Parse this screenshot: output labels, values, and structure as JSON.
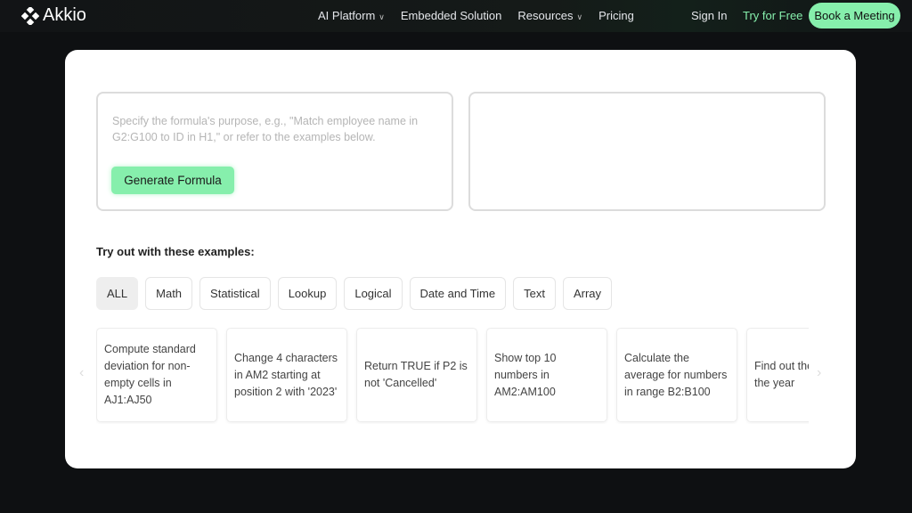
{
  "nav": {
    "brand": "Akkio",
    "links": [
      {
        "label": "AI Platform",
        "dropdown": true
      },
      {
        "label": "Embedded Solution",
        "dropdown": false
      },
      {
        "label": "Resources",
        "dropdown": true
      },
      {
        "label": "Pricing",
        "dropdown": false
      }
    ],
    "sign_in": "Sign In",
    "try_free": "Try for Free",
    "book_meeting": "Book a Meeting"
  },
  "form": {
    "placeholder": "Specify the formula's purpose, e.g., \"Match employee name in G2:G100 to ID in H1,\" or refer to the examples below.",
    "generate_label": "Generate Formula",
    "output": ""
  },
  "examples": {
    "heading": "Try out with these examples:",
    "categories": [
      "ALL",
      "Math",
      "Statistical",
      "Lookup",
      "Logical",
      "Date and Time",
      "Text",
      "Array"
    ],
    "active": "ALL",
    "cards": [
      "Compute standard deviation for non-empty cells in AJ1:AJ50",
      "Change 4 characters in AM2 starting at position 2 with '2023'",
      "Return TRUE if P2 is not 'Cancelled'",
      "Show top 10 numbers in AM2:AM100",
      "Calculate the average for numbers in range B2:B100",
      "Find out the day of the year"
    ]
  },
  "colors": {
    "accent": "#86efac",
    "background": "#0e1012"
  }
}
